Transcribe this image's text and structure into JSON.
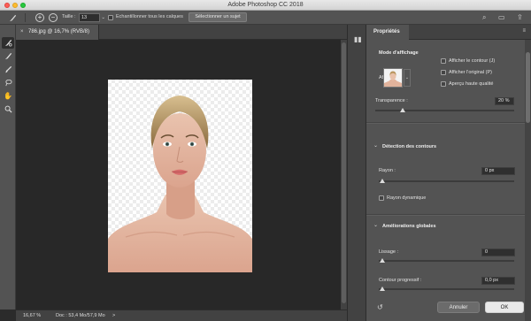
{
  "window": {
    "title": "Adobe Photoshop CC 2018"
  },
  "options_bar": {
    "size_label": "Taille :",
    "size_value": "13",
    "sample_all_layers": "Echantillonner tous les calques",
    "select_subject": "Sélectionner un sujet"
  },
  "document": {
    "tab_title": "786.jpg @ 16,7% (RVB/8)",
    "zoom": "16,67 %",
    "doc_info": "Doc : 53,4 Mo/57,9 Mo",
    "status_arrow": ">"
  },
  "properties": {
    "tab": "Propriétés",
    "view_mode_title": "Mode d'affichage",
    "view_label": "Affichage :",
    "show_edge": "Afficher le contour (J)",
    "show_original": "Afficher l'original (P)",
    "high_quality_preview": "Aperçu haute qualité",
    "transparency_label": "Transparence :",
    "transparency_value": "20 %",
    "transparency_level": 0.2,
    "edge_detection_title": "Détection des contours",
    "radius_label": "Rayon :",
    "radius_value": "0 px",
    "smart_radius": "Rayon dynamique",
    "global_refinements_title": "Améliorations globales",
    "smooth_label": "Lissage :",
    "smooth_value": "0",
    "feather_label": "Contour progressif :",
    "feather_value": "0,0 px",
    "cancel": "Annuler",
    "ok": "OK"
  },
  "colors": {
    "panel_bg": "#535353",
    "canvas_bg": "#282828",
    "ok_button": "#e9e9e9"
  }
}
